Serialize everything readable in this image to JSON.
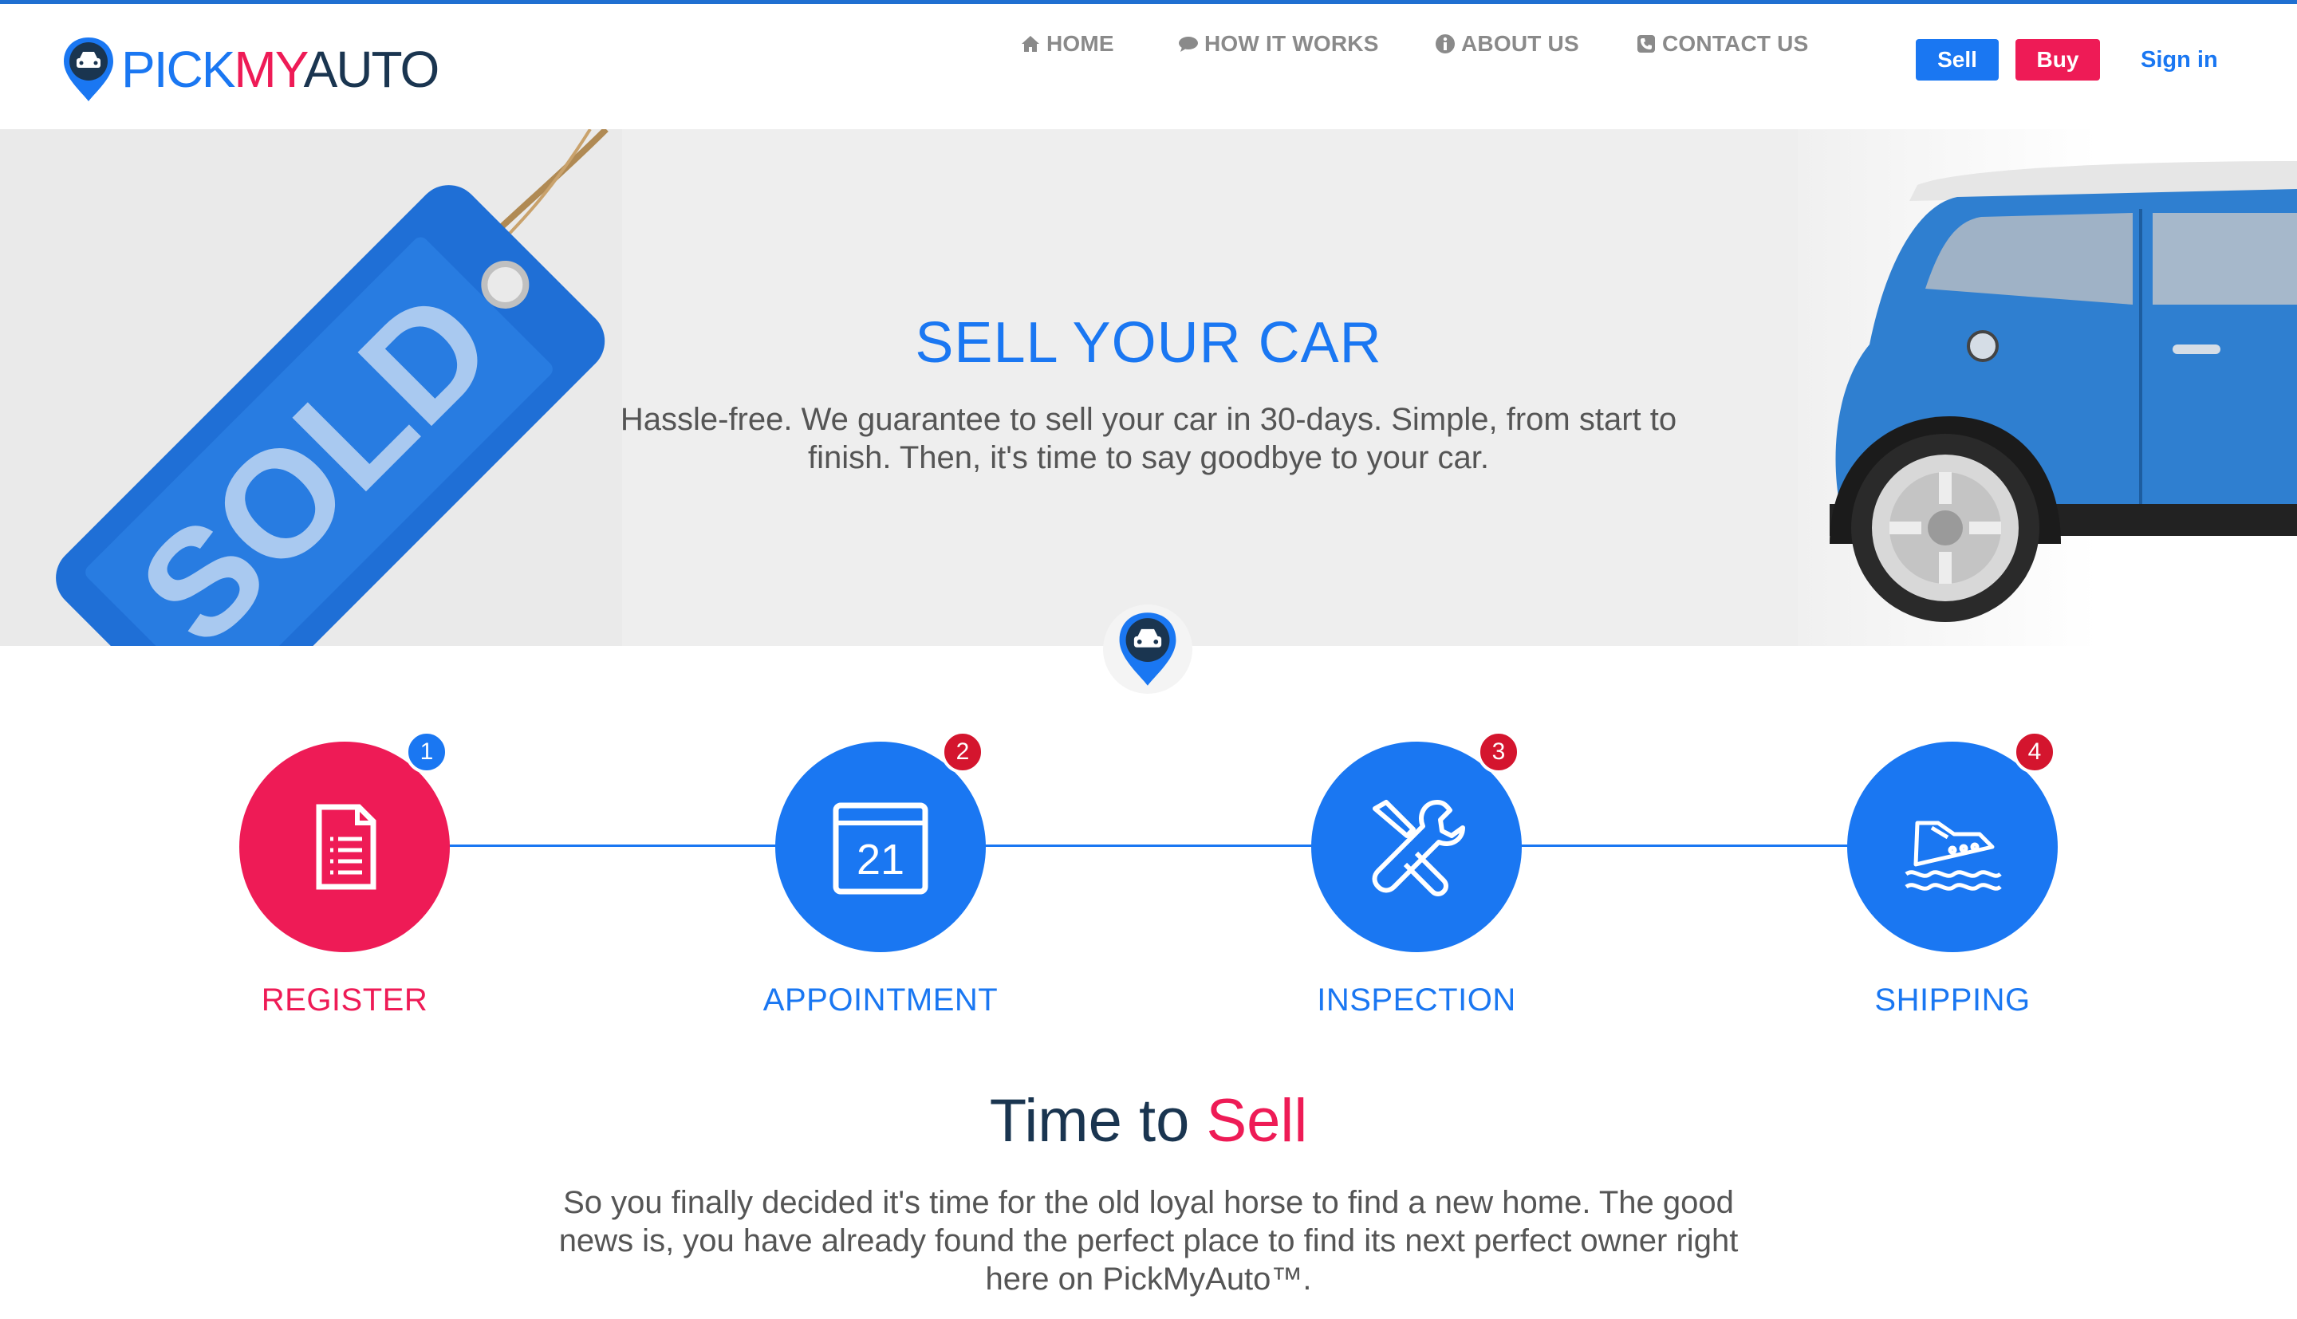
{
  "brand": {
    "logo_pick": "PICK",
    "logo_my": "MY",
    "logo_auto": "AUTO",
    "colors": {
      "blue": "#1a77f2",
      "pink": "#ee1b56",
      "navy": "#1a3550"
    }
  },
  "nav": {
    "home": "HOME",
    "how": "HOW IT WORKS",
    "about": "ABOUT US",
    "contact": "CONTACT US",
    "icons": [
      "home-icon",
      "comments-icon",
      "info-icon",
      "phone-icon"
    ]
  },
  "actions": {
    "sell": "Sell",
    "buy": "Buy",
    "signin": "Sign in"
  },
  "hero": {
    "title": "SELL YOUR CAR",
    "description": "Hassle-free. We guarantee to sell your car in 30-days. Simple, from start to finish. Then, it's time to say goodbye to your car.",
    "tag_text": "SOLD"
  },
  "steps": [
    {
      "number": "1",
      "label": "REGISTER",
      "icon": "document-icon",
      "color": "#ee1b56"
    },
    {
      "number": "2",
      "label": "APPOINTMENT",
      "icon": "calendar-icon",
      "calendar_day": "21",
      "color": "#1a77f2"
    },
    {
      "number": "3",
      "label": "INSPECTION",
      "icon": "tools-icon",
      "color": "#1a77f2"
    },
    {
      "number": "4",
      "label": "SHIPPING",
      "icon": "ship-icon",
      "color": "#1a77f2"
    }
  ],
  "time_to_sell": {
    "title_part1": "Time to ",
    "title_part2": "Sell",
    "text": "So you finally decided it's time for the old loyal horse to find a new home. The good news is, you have already found the perfect place to find its next perfect owner right here on PickMyAuto™."
  }
}
